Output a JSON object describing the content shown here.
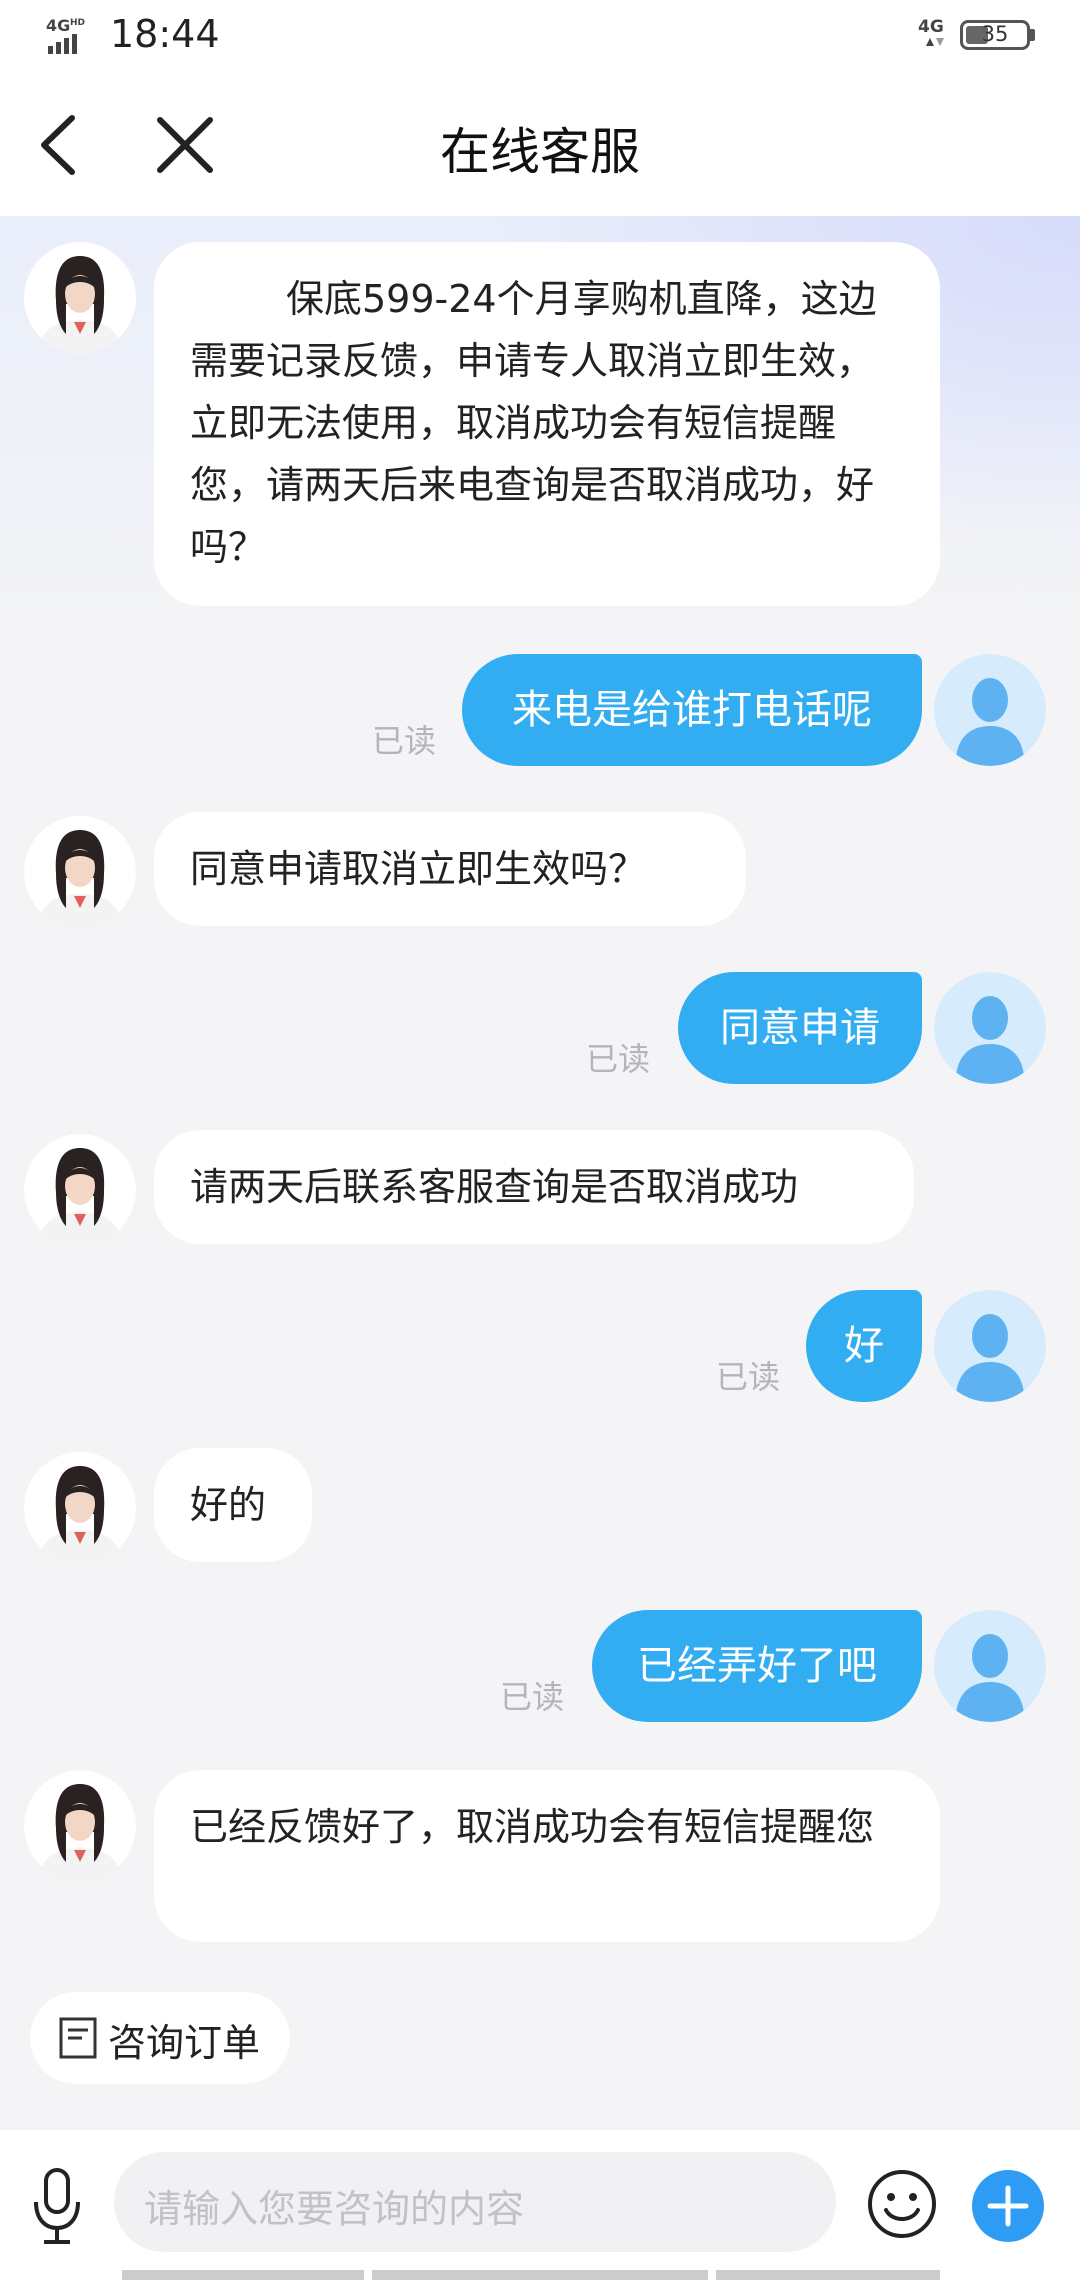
{
  "status_bar": {
    "time": "18:44",
    "network": "4G",
    "network_sub": "HD",
    "network_right": "4G",
    "battery": "35"
  },
  "header": {
    "title": "在线客服"
  },
  "messages": [
    {
      "from": "agent",
      "text": "保底599-24个月享购机直降，这边需要记录反馈，申请专人取消立即生效，立即无法使用，取消成功会有短信提醒您，请两天后来电查询是否取消成功，好吗？"
    },
    {
      "from": "user",
      "text": "来电是给谁打电话呢",
      "status": "已读"
    },
    {
      "from": "agent",
      "text": "同意申请取消立即生效吗？"
    },
    {
      "from": "user",
      "text": "同意申请",
      "status": "已读"
    },
    {
      "from": "agent",
      "text": "请两天后联系客服查询是否取消成功"
    },
    {
      "from": "user",
      "text": "好",
      "status": "已读"
    },
    {
      "from": "agent",
      "text": "好的"
    },
    {
      "from": "user",
      "text": "已经弄好了吧",
      "status": "已读"
    },
    {
      "from": "agent",
      "text": "已经反馈好了，取消成功会有短信提醒您"
    }
  ],
  "quick_action": {
    "label": "咨询订单",
    "icon": "order-doc-icon"
  },
  "input": {
    "placeholder": "请输入您要咨询的内容"
  },
  "colors": {
    "user_bubble": "#33adf2",
    "plus_button": "#2e9cf4",
    "read_text": "#b5b5b8"
  }
}
